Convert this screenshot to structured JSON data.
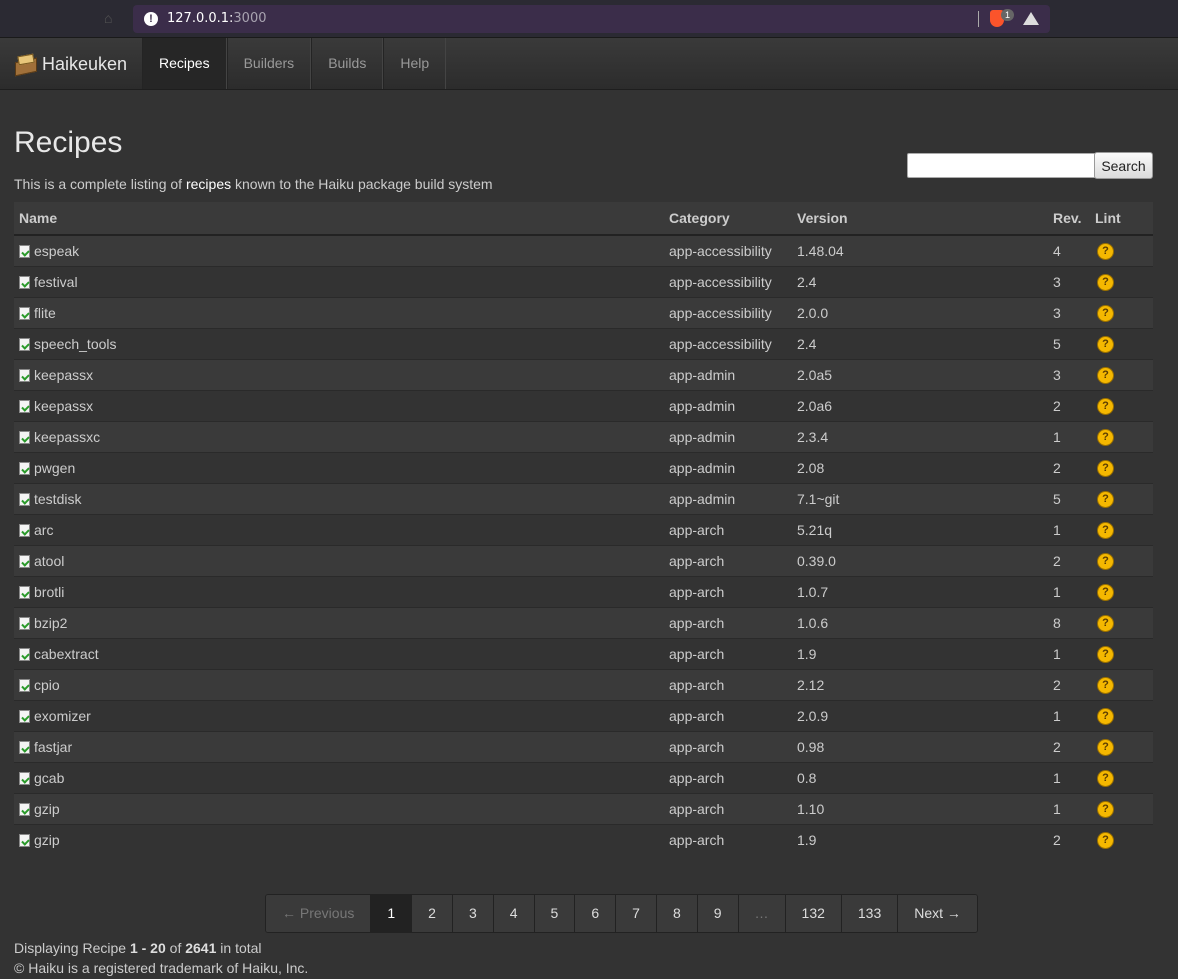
{
  "browser": {
    "url_host": "127.0.0.1:",
    "url_port": "3000",
    "warning_glyph": "!",
    "brave_badge": "1"
  },
  "nav": {
    "brand": "Haikeuken",
    "items": [
      {
        "label": "Recipes",
        "active": true
      },
      {
        "label": "Builders",
        "active": false
      },
      {
        "label": "Builds",
        "active": false
      },
      {
        "label": "Help",
        "active": false
      }
    ]
  },
  "page": {
    "title": "Recipes",
    "subtitle_prefix": "This is a complete listing of ",
    "subtitle_highlight": "recipes",
    "subtitle_suffix": " known to the Haiku package build system"
  },
  "search": {
    "placeholder": "",
    "button_label": "Search"
  },
  "table": {
    "headers": [
      "Name",
      "Category",
      "Version",
      "Rev.",
      "Lint"
    ],
    "lint_glyph": "?",
    "rows": [
      {
        "name": "espeak",
        "category": "app-accessibility",
        "version": "1.48.04",
        "rev": "4"
      },
      {
        "name": "festival",
        "category": "app-accessibility",
        "version": "2.4",
        "rev": "3"
      },
      {
        "name": "flite",
        "category": "app-accessibility",
        "version": "2.0.0",
        "rev": "3"
      },
      {
        "name": "speech_tools",
        "category": "app-accessibility",
        "version": "2.4",
        "rev": "5"
      },
      {
        "name": "keepassx",
        "category": "app-admin",
        "version": "2.0a5",
        "rev": "3"
      },
      {
        "name": "keepassx",
        "category": "app-admin",
        "version": "2.0a6",
        "rev": "2"
      },
      {
        "name": "keepassxc",
        "category": "app-admin",
        "version": "2.3.4",
        "rev": "1"
      },
      {
        "name": "pwgen",
        "category": "app-admin",
        "version": "2.08",
        "rev": "2"
      },
      {
        "name": "testdisk",
        "category": "app-admin",
        "version": "7.1~git",
        "rev": "5"
      },
      {
        "name": "arc",
        "category": "app-arch",
        "version": "5.21q",
        "rev": "1"
      },
      {
        "name": "atool",
        "category": "app-arch",
        "version": "0.39.0",
        "rev": "2"
      },
      {
        "name": "brotli",
        "category": "app-arch",
        "version": "1.0.7",
        "rev": "1"
      },
      {
        "name": "bzip2",
        "category": "app-arch",
        "version": "1.0.6",
        "rev": "8"
      },
      {
        "name": "cabextract",
        "category": "app-arch",
        "version": "1.9",
        "rev": "1"
      },
      {
        "name": "cpio",
        "category": "app-arch",
        "version": "2.12",
        "rev": "2"
      },
      {
        "name": "exomizer",
        "category": "app-arch",
        "version": "2.0.9",
        "rev": "1"
      },
      {
        "name": "fastjar",
        "category": "app-arch",
        "version": "0.98",
        "rev": "2"
      },
      {
        "name": "gcab",
        "category": "app-arch",
        "version": "0.8",
        "rev": "1"
      },
      {
        "name": "gzip",
        "category": "app-arch",
        "version": "1.10",
        "rev": "1"
      },
      {
        "name": "gzip",
        "category": "app-arch",
        "version": "1.9",
        "rev": "2"
      }
    ]
  },
  "pagination": {
    "items": [
      {
        "label": "← Previous",
        "state": "disabled"
      },
      {
        "label": "1",
        "state": "active"
      },
      {
        "label": "2",
        "state": ""
      },
      {
        "label": "3",
        "state": ""
      },
      {
        "label": "4",
        "state": ""
      },
      {
        "label": "5",
        "state": ""
      },
      {
        "label": "6",
        "state": ""
      },
      {
        "label": "7",
        "state": ""
      },
      {
        "label": "8",
        "state": ""
      },
      {
        "label": "9",
        "state": ""
      },
      {
        "label": "…",
        "state": "disabled"
      },
      {
        "label": "132",
        "state": ""
      },
      {
        "label": "133",
        "state": ""
      },
      {
        "label": "Next →",
        "state": ""
      }
    ]
  },
  "footer": {
    "display_prefix": "Displaying Recipe ",
    "display_range": "1 - 20",
    "display_of": " of ",
    "display_total": "2641",
    "display_suffix": " in total",
    "copyright": "© Haiku is a registered trademark of Haiku, Inc."
  }
}
